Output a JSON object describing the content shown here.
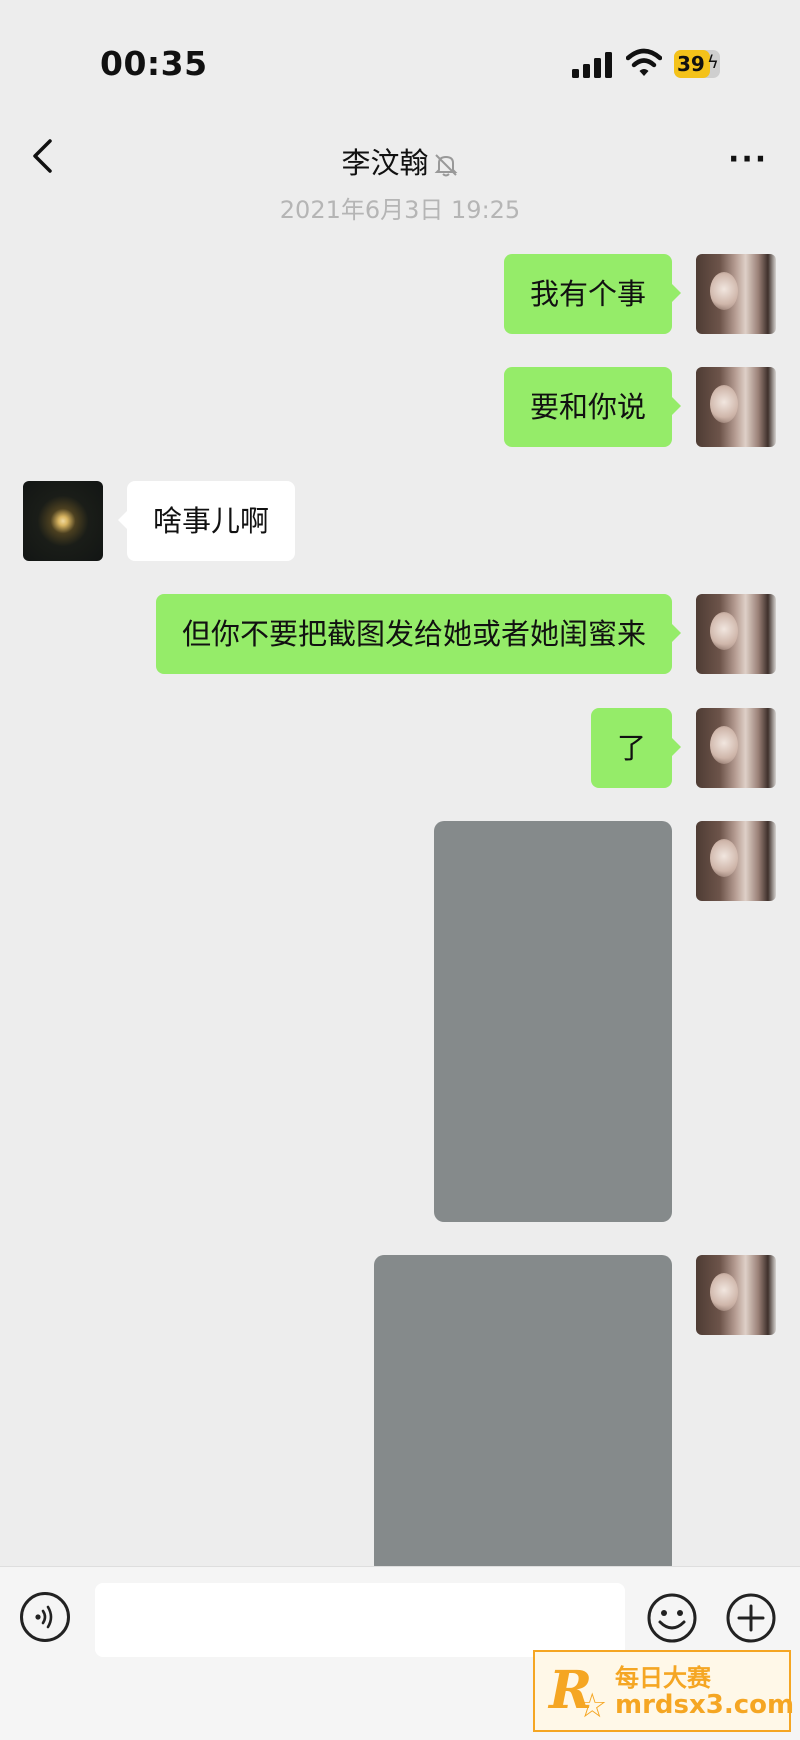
{
  "status_bar": {
    "time": "00:35",
    "battery_level": "39",
    "battery_percent": 39,
    "battery_color": "#f4c21a"
  },
  "header": {
    "contact_name": "李汶翰",
    "icons": [
      "back-chevron-icon",
      "muted-bell-icon",
      "more-dots-icon"
    ],
    "more_label": "···"
  },
  "chat": {
    "timestamp": "2021年6月3日 19:25",
    "messages": [
      {
        "sender": "me",
        "type": "text",
        "text": "我有个事"
      },
      {
        "sender": "me",
        "type": "text",
        "text": "要和你说"
      },
      {
        "sender": "other",
        "type": "text",
        "text": "啥事儿啊"
      },
      {
        "sender": "me",
        "type": "text",
        "text": "但你不要把截图发给她或者她闺蜜来"
      },
      {
        "sender": "me",
        "type": "text",
        "text": "了"
      },
      {
        "sender": "me",
        "type": "image"
      },
      {
        "sender": "me",
        "type": "image"
      }
    ],
    "colors": {
      "my_bubble": "#95ec69",
      "their_bubble": "#ffffff",
      "background": "#ededed",
      "image_placeholder": "#858a8b"
    }
  },
  "input_bar": {
    "icons": [
      "voice-icon",
      "emoji-icon",
      "plus-icon"
    ]
  },
  "watermark": {
    "logo": "R",
    "name": "每日大赛",
    "url": "mrdsx3.com"
  }
}
